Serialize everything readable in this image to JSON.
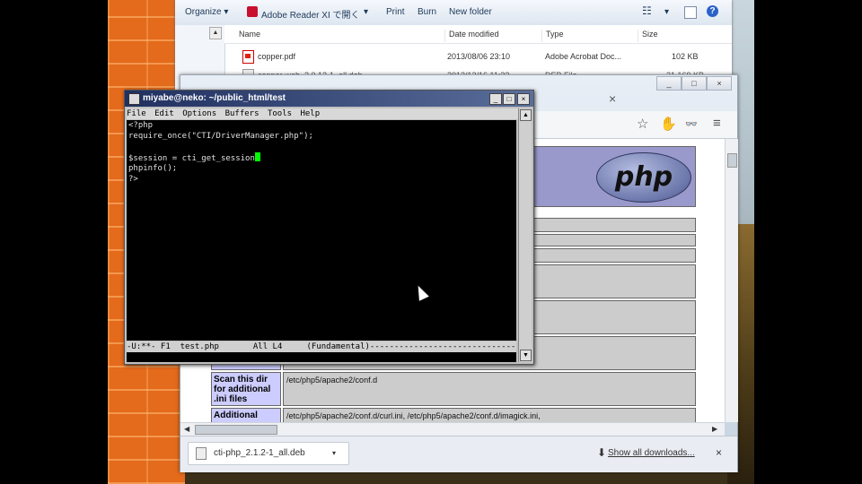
{
  "explorer": {
    "toolbar": {
      "organize": "Organize",
      "adobe_reader": "Adobe Reader XI で開く",
      "print": "Print",
      "burn": "Burn",
      "new_folder": "New folder"
    },
    "columns": {
      "name": "Name",
      "date": "Date modified",
      "type": "Type",
      "size": "Size"
    },
    "files": [
      {
        "name": "copper.pdf",
        "date": "2013/08/06 23:10",
        "type": "Adobe Acrobat Doc...",
        "size": "102 KB"
      },
      {
        "name": "copper-web_2.0.13-1_all.deb",
        "date": "2013/12/16 11:22",
        "type": "DEB File",
        "size": "21,169 KB"
      }
    ]
  },
  "chrome": {
    "tab_close": "×",
    "content": {
      "logo_text": "php",
      "system_fragment": "39:32 UTC 2013 x86_64",
      "rows": [
        {
          "key": "Scan this dir for additional .ini files",
          "value": "/etc/php5/apache2/conf.d"
        },
        {
          "key": "Additional",
          "value": "/etc/php5/apache2/conf.d/curl.ini, /etc/php5/apache2/conf.d/imagick.ini,"
        }
      ]
    },
    "download_bar": {
      "file": "cti-php_2.1.2-1_all.deb",
      "show_all": "Show all downloads...",
      "close": "×"
    }
  },
  "emacs": {
    "title": "miyabe@neko: ~/public_html/test",
    "menu": [
      "File",
      "Edit",
      "Options",
      "Buffers",
      "Tools",
      "Help"
    ],
    "lines": [
      "<?php",
      "require_once(\"CTI/DriverManager.php\");",
      "",
      "$session = cti_get_session",
      "phpinfo();",
      "?>"
    ],
    "modeline": "-U:**- F1  test.php       All L4     (Fundamental)--------------------------------"
  },
  "icons": {
    "window_min": "_",
    "window_max": "□",
    "window_close": "×"
  }
}
